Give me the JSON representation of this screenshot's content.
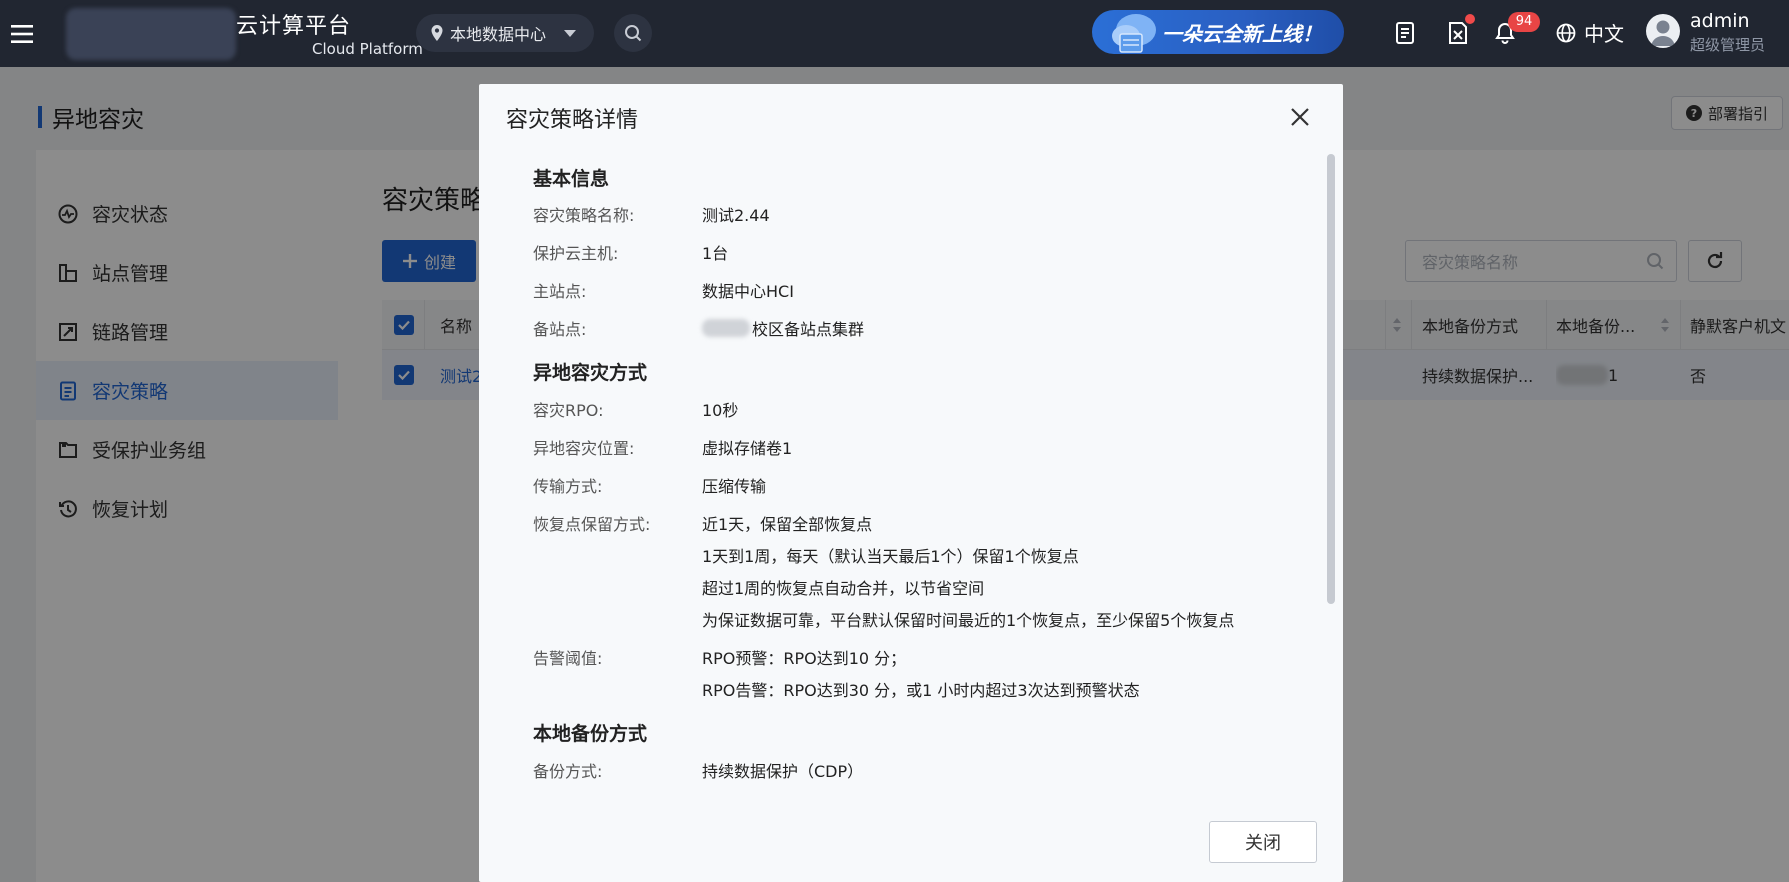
{
  "topbar": {
    "brand_title": "云计算平台",
    "brand_subtitle": "Cloud Platform",
    "datacenter": "本地数据中心",
    "banner_text": "一朵云全新上线！",
    "notification_count": "94",
    "language": "中文",
    "user_name": "admin",
    "user_role": "超级管理员"
  },
  "page": {
    "title": "异地容灾",
    "deploy_guide": "部署指引"
  },
  "sidebar": {
    "items": [
      {
        "label": "容灾状态",
        "icon": "dr-status-icon"
      },
      {
        "label": "站点管理",
        "icon": "site-icon"
      },
      {
        "label": "链路管理",
        "icon": "link-icon"
      },
      {
        "label": "容灾策略",
        "icon": "policy-icon"
      },
      {
        "label": "受保护业务组",
        "icon": "folder-icon"
      },
      {
        "label": "恢复计划",
        "icon": "history-icon"
      }
    ],
    "active_index": 3
  },
  "content": {
    "title": "容灾策略",
    "create_label": "创建",
    "search_placeholder": "容灾策略名称",
    "table": {
      "headers": [
        "名称",
        "本地备份方式",
        "本地备份...",
        "静默客户机文"
      ],
      "row": {
        "name": "测试2",
        "backup_mode": "持续数据保护...",
        "backup_tail": "1",
        "quiesce": "否"
      }
    }
  },
  "modal": {
    "title": "容灾策略详情",
    "sections": {
      "basic": "基本信息",
      "remote": "异地容灾方式",
      "local": "本地备份方式"
    },
    "fields": {
      "policy_name_label": "容灾策略名称:",
      "policy_name": "测试2.44",
      "protected_vm_label": "保护云主机:",
      "protected_vm": "1台",
      "primary_site_label": "主站点:",
      "primary_site": "数据中心HCI",
      "backup_site_label": "备站点:",
      "backup_site": "校区备站点集群",
      "rpo_label": "容灾RPO:",
      "rpo": "10秒",
      "location_label": "异地容灾位置:",
      "location": "虚拟存储卷1",
      "transfer_label": "传输方式:",
      "transfer": "压缩传输",
      "retention_label": "恢复点保留方式:",
      "retention_1": "近1天，保留全部恢复点",
      "retention_2": "1天到1周，每天（默认当天最后1个）保留1个恢复点",
      "retention_3": "超过1周的恢复点自动合并，以节省空间",
      "retention_4": "为保证数据可靠，平台默认保留时间最近的1个恢复点，至少保留5个恢复点",
      "alarm_label": "告警阈值:",
      "alarm_1": "RPO预警：RPO达到10 分；",
      "alarm_2": "RPO告警：RPO达到30 分，或1 小时内超过3次达到预警状态",
      "backup_mode_label": "备份方式:",
      "backup_mode": "持续数据保护（CDP）"
    },
    "close_label": "关闭"
  }
}
